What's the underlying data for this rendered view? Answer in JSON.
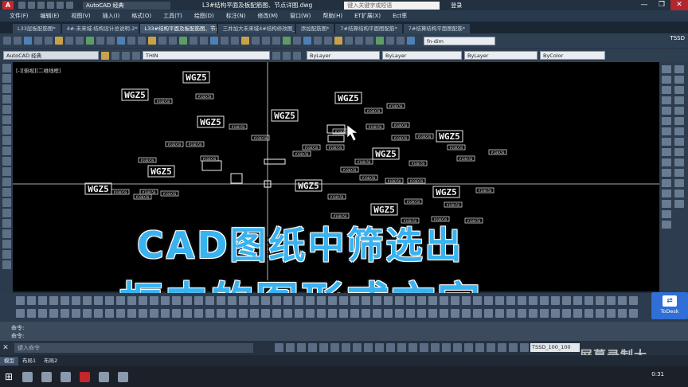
{
  "app": {
    "logo": "A",
    "workspace": "AutoCAD 经典",
    "document_title": "L3#结构平面及板配筋图、节点详图.dwg",
    "search_placeholder": "键入关键字或短语",
    "login": "登录",
    "window_controls": [
      "—",
      "❐",
      "✕"
    ]
  },
  "menu": [
    "文件(F)",
    "编辑(E)",
    "视图(V)",
    "插入(I)",
    "格式(O)",
    "工具(T)",
    "绘图(D)",
    "标注(N)",
    "修改(M)",
    "窗口(W)",
    "帮助(H)",
    "ET扩展(X)",
    "Ect率"
  ],
  "file_tabs": [
    "L33层板配筋图*",
    "4#-未来城-结构设计总说明-2*",
    "L33#结构平面及板配筋图、节点详图*",
    "三井加大未来城4#结构修改图_20190517*",
    "添加配筋图*",
    "7#结算结构平面图配筋*",
    "7#结算结构平面图配筋*"
  ],
  "active_file_tab": 2,
  "toolbar": {
    "workspace_combo": "AutoCAD 经典",
    "layer_combo": "THIN",
    "color_combo": "ByLayer",
    "linetype_combo": "ByLayer",
    "lineweight_combo": "ByLayer",
    "plotstyle_combo": "ByColor",
    "dimstyle_combo": "fn-dim",
    "plugin": "TSSD"
  },
  "canvas": {
    "view_label": "[-][俯视][二维线框]",
    "block_label": "WGZ5",
    "small_label": "#100X50",
    "background": "#000000",
    "caption_line1": "CAD图纸中筛选出",
    "caption_line2": "框内的图形或文字",
    "caption_color": "#39b3f0"
  },
  "command": {
    "history": [
      "命令:",
      "命令:"
    ],
    "placeholder": "键入命令",
    "close": "✕"
  },
  "status": {
    "model_tab": "模型",
    "scale_combo": "TSSD_100_100"
  },
  "layout_tabs": [
    "模型",
    "布局1",
    "布局2"
  ],
  "taskbar": {
    "clock": "0:31"
  },
  "todesk": {
    "label": "ToDesk"
  },
  "watermark": "屏幕录制大"
}
